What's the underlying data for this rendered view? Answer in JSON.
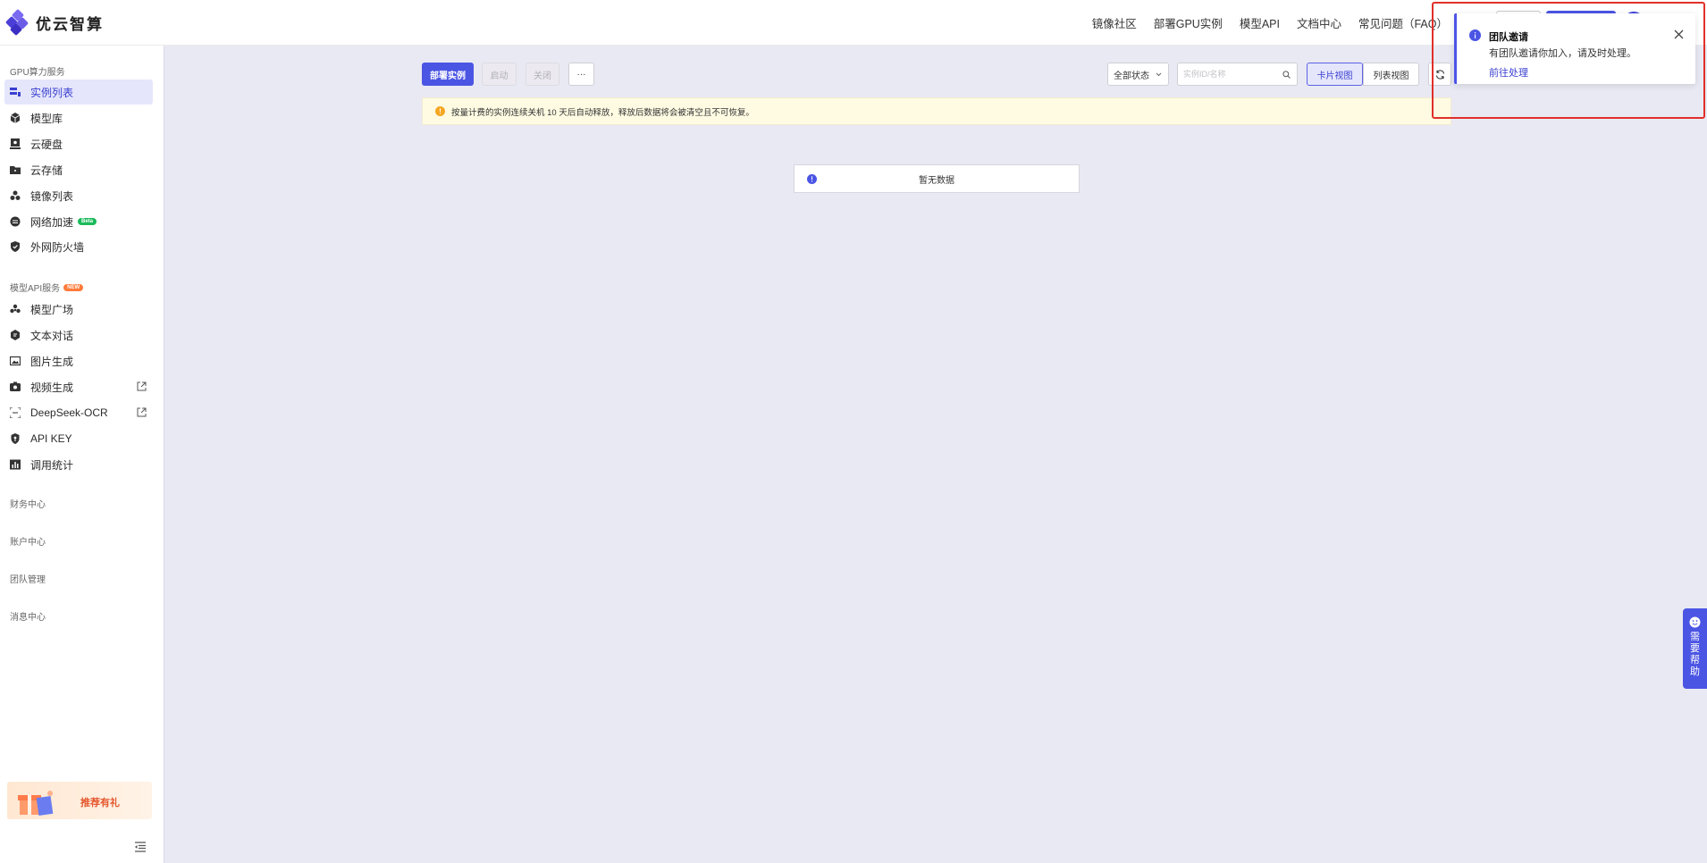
{
  "app": {
    "name": "优云智算"
  },
  "topnav": {
    "items": [
      "镜像社区",
      "部署GPU实例",
      "模型API",
      "文档中心",
      "常见问题（FAQ）"
    ]
  },
  "sidebar": {
    "gpu_section": "GPU算力服务",
    "gpu_items": [
      {
        "label": "实例列表",
        "icon": "server-list-icon",
        "active": true
      },
      {
        "label": "模型库",
        "icon": "cube-icon"
      },
      {
        "label": "云硬盘",
        "icon": "disk-icon"
      },
      {
        "label": "云存储",
        "icon": "folder-icon"
      },
      {
        "label": "镜像列表",
        "icon": "images-icon"
      },
      {
        "label": "网络加速",
        "icon": "network-icon",
        "badge": "Beta"
      },
      {
        "label": "外网防火墙",
        "icon": "shield-icon"
      }
    ],
    "api_section": "模型API服务",
    "api_badge": "NEW",
    "api_items": [
      {
        "label": "模型广场",
        "icon": "model-square-icon"
      },
      {
        "label": "文本对话",
        "icon": "chat-icon"
      },
      {
        "label": "图片生成",
        "icon": "image-icon"
      },
      {
        "label": "视频生成",
        "icon": "video-icon",
        "external": true
      },
      {
        "label": "DeepSeek-OCR",
        "icon": "scan-icon",
        "external": true
      },
      {
        "label": "API KEY",
        "icon": "key-icon"
      },
      {
        "label": "调用统计",
        "icon": "stats-icon"
      }
    ],
    "sections": [
      "财务中心",
      "账户中心",
      "团队管理",
      "消息中心"
    ],
    "promo": "推荐有礼"
  },
  "toolbar": {
    "deploy": "部署实例",
    "start": "启动",
    "stop": "关闭",
    "more": "···",
    "status_select": "全部状态",
    "search_placeholder": "实例ID/名称",
    "card_view": "卡片视图",
    "list_view": "列表视图"
  },
  "alert": {
    "text": "按量计费的实例连续关机 10 天后自动释放，释放后数据将会被清空且不可恢复。"
  },
  "empty": {
    "text": "暂无数据"
  },
  "notification": {
    "title": "团队邀请",
    "body": "有团队邀请你加入，请及时处理。",
    "link": "前往处理"
  },
  "help": {
    "label": "需要帮助"
  },
  "colors": {
    "accent": "#4b55e4",
    "highlight": "#e0302a",
    "alert_bg": "#fefbe2"
  }
}
